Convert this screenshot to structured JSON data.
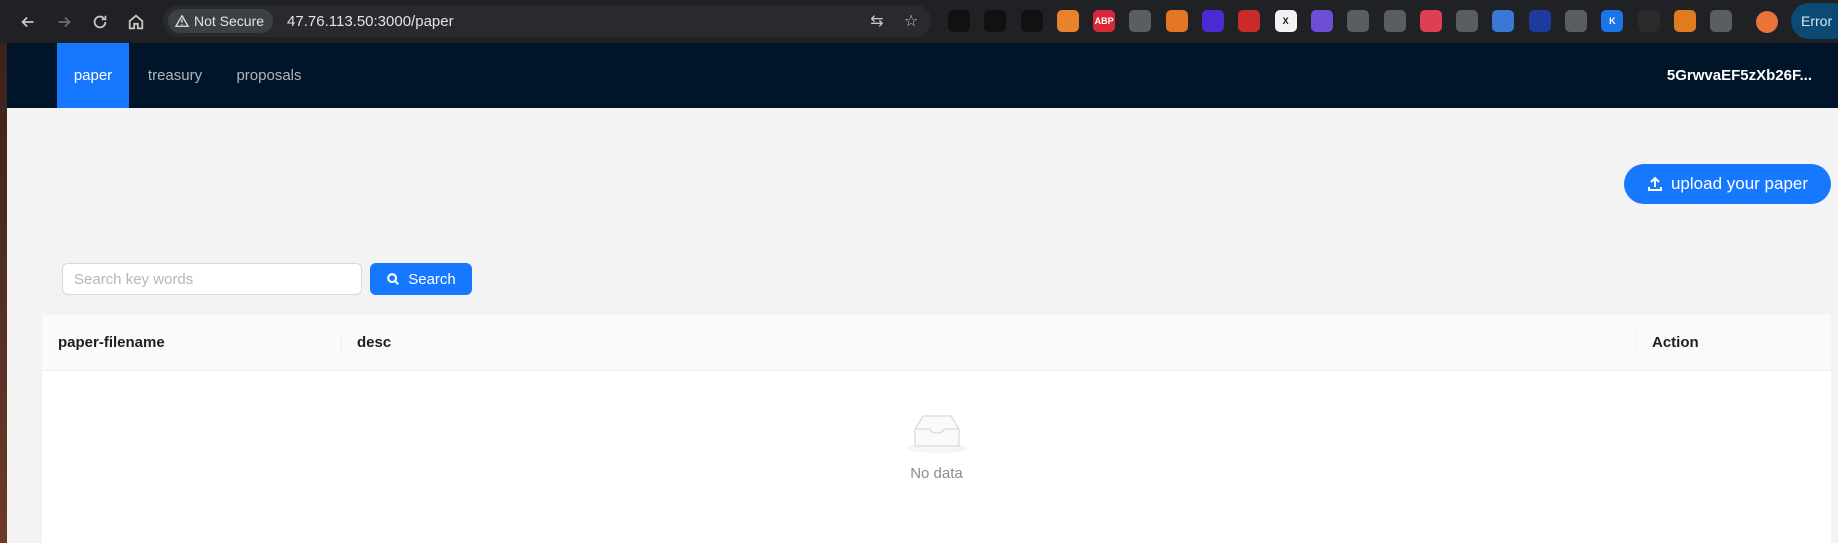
{
  "browser": {
    "security_label": "Not Secure",
    "url": "47.76.113.50:3000/paper",
    "extensions": [
      {
        "icon": "circle-dark-icon",
        "color": "#111111"
      },
      {
        "icon": "square-frame-icon",
        "color": "#111111"
      },
      {
        "icon": "ring-icon",
        "color": "#111111"
      },
      {
        "icon": "orange-coin-icon",
        "color": "#e8832b"
      },
      {
        "icon": "adblock-plus-icon",
        "color": "#d92638",
        "text": "ABP"
      },
      {
        "icon": "vee-icon",
        "color": "#5a5d61"
      },
      {
        "icon": "fox-mask-icon",
        "color": "#e27625"
      },
      {
        "icon": "purple-cube-icon",
        "color": "#4b2bd1"
      },
      {
        "icon": "red-badge-icon",
        "color": "#c92a2a"
      },
      {
        "icon": "x-icon",
        "color": "#f2f2f2",
        "text": "X"
      },
      {
        "icon": "purple-ghost-icon",
        "color": "#6c4fd4"
      },
      {
        "icon": "bracket-icon",
        "color": "#5a5d61"
      },
      {
        "icon": "grid-icon",
        "color": "#5a5d61"
      },
      {
        "icon": "red-square-icon",
        "color": "#e03e52"
      },
      {
        "icon": "camera-icon",
        "color": "#5a5d61"
      },
      {
        "icon": "translate-icon",
        "color": "#3a78d6"
      },
      {
        "icon": "blue-circle-icon",
        "color": "#1d3a9c"
      },
      {
        "icon": "copy-icon",
        "color": "#5a5d61"
      },
      {
        "icon": "k-icon",
        "color": "#1b74e8",
        "text": "K"
      },
      {
        "icon": "sparkle-icon",
        "color": "#2a2a2a"
      },
      {
        "icon": "orange-helmet-icon",
        "color": "#e07b20"
      },
      {
        "icon": "puzzle-icon",
        "color": "#5a5d61"
      }
    ],
    "status_label": "Error"
  },
  "nav": {
    "items": [
      {
        "label": "paper",
        "active": true
      },
      {
        "label": "treasury",
        "active": false
      },
      {
        "label": "proposals",
        "active": false
      }
    ],
    "account": "5GrwvaEF5zXb26F..."
  },
  "actions": {
    "upload_label": "upload your paper"
  },
  "search": {
    "placeholder": "Search key words",
    "button_label": "Search"
  },
  "table": {
    "columns": [
      "paper-filename",
      "desc",
      "Action"
    ],
    "empty_text": "No data"
  },
  "colors": {
    "primary": "#1677ff",
    "header_bg": "#001529",
    "page_bg": "#f3f3f3"
  }
}
